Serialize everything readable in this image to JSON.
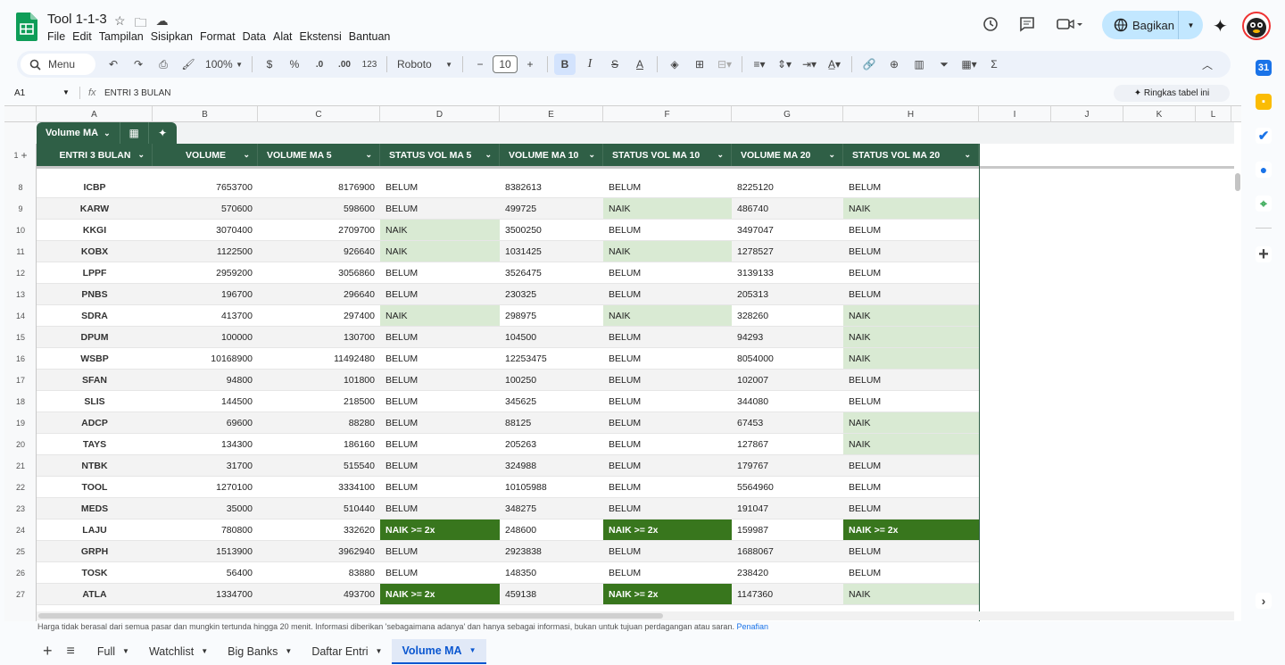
{
  "doc": {
    "title": "Tool 1-1-3"
  },
  "menu": [
    "File",
    "Edit",
    "Tampilan",
    "Sisipkan",
    "Format",
    "Data",
    "Alat",
    "Ekstensi",
    "Bantuan"
  ],
  "share": {
    "label": "Bagikan"
  },
  "toolbar": {
    "search": "Menu",
    "zoom": "100%",
    "currency": "$",
    "percent": "%",
    "dec_less": ".0",
    "dec_more": ".00",
    "num_format": "123",
    "font": "Roboto",
    "font_size": "10",
    "bold": "B",
    "italic": "I",
    "strike": "S",
    "text_color": "A"
  },
  "formula": {
    "cell": "A1",
    "fx": "fx",
    "content": "ENTRI 3 BULAN",
    "summarize": "Ringkas tabel ini"
  },
  "columns": [
    "A",
    "B",
    "C",
    "D",
    "E",
    "F",
    "G",
    "H",
    "I",
    "J",
    "K",
    "L"
  ],
  "table": {
    "name": "Volume MA",
    "headers": [
      "ENTRI 3 BULAN",
      "VOLUME",
      "VOLUME MA 5",
      "STATUS VOL MA 5",
      "VOLUME MA 10",
      "STATUS VOL MA 10",
      "VOLUME MA 20",
      "STATUS VOL MA 20"
    ],
    "rows": [
      {
        "n": "8",
        "t": "ICBP",
        "v": "7653700",
        "m5": "8176900",
        "s5": "BELUM",
        "m10": "8382613",
        "s10": "BELUM",
        "m20": "8225120",
        "s20": "BELUM"
      },
      {
        "n": "9",
        "t": "KARW",
        "v": "570600",
        "m5": "598600",
        "s5": "BELUM",
        "m10": "499725",
        "s10": "NAIK",
        "m20": "486740",
        "s20": "NAIK"
      },
      {
        "n": "10",
        "t": "KKGI",
        "v": "3070400",
        "m5": "2709700",
        "s5": "NAIK",
        "m10": "3500250",
        "s10": "BELUM",
        "m20": "3497047",
        "s20": "BELUM"
      },
      {
        "n": "11",
        "t": "KOBX",
        "v": "1122500",
        "m5": "926640",
        "s5": "NAIK",
        "m10": "1031425",
        "s10": "NAIK",
        "m20": "1278527",
        "s20": "BELUM"
      },
      {
        "n": "12",
        "t": "LPPF",
        "v": "2959200",
        "m5": "3056860",
        "s5": "BELUM",
        "m10": "3526475",
        "s10": "BELUM",
        "m20": "3139133",
        "s20": "BELUM"
      },
      {
        "n": "13",
        "t": "PNBS",
        "v": "196700",
        "m5": "296640",
        "s5": "BELUM",
        "m10": "230325",
        "s10": "BELUM",
        "m20": "205313",
        "s20": "BELUM"
      },
      {
        "n": "14",
        "t": "SDRA",
        "v": "413700",
        "m5": "297400",
        "s5": "NAIK",
        "m10": "298975",
        "s10": "NAIK",
        "m20": "328260",
        "s20": "NAIK"
      },
      {
        "n": "15",
        "t": "DPUM",
        "v": "100000",
        "m5": "130700",
        "s5": "BELUM",
        "m10": "104500",
        "s10": "BELUM",
        "m20": "94293",
        "s20": "NAIK"
      },
      {
        "n": "16",
        "t": "WSBP",
        "v": "10168900",
        "m5": "11492480",
        "s5": "BELUM",
        "m10": "12253475",
        "s10": "BELUM",
        "m20": "8054000",
        "s20": "NAIK"
      },
      {
        "n": "17",
        "t": "SFAN",
        "v": "94800",
        "m5": "101800",
        "s5": "BELUM",
        "m10": "100250",
        "s10": "BELUM",
        "m20": "102007",
        "s20": "BELUM"
      },
      {
        "n": "18",
        "t": "SLIS",
        "v": "144500",
        "m5": "218500",
        "s5": "BELUM",
        "m10": "345625",
        "s10": "BELUM",
        "m20": "344080",
        "s20": "BELUM"
      },
      {
        "n": "19",
        "t": "ADCP",
        "v": "69600",
        "m5": "88280",
        "s5": "BELUM",
        "m10": "88125",
        "s10": "BELUM",
        "m20": "67453",
        "s20": "NAIK"
      },
      {
        "n": "20",
        "t": "TAYS",
        "v": "134300",
        "m5": "186160",
        "s5": "BELUM",
        "m10": "205263",
        "s10": "BELUM",
        "m20": "127867",
        "s20": "NAIK"
      },
      {
        "n": "21",
        "t": "NTBK",
        "v": "31700",
        "m5": "515540",
        "s5": "BELUM",
        "m10": "324988",
        "s10": "BELUM",
        "m20": "179767",
        "s20": "BELUM"
      },
      {
        "n": "22",
        "t": "TOOL",
        "v": "1270100",
        "m5": "3334100",
        "s5": "BELUM",
        "m10": "10105988",
        "s10": "BELUM",
        "m20": "5564960",
        "s20": "BELUM"
      },
      {
        "n": "23",
        "t": "MEDS",
        "v": "35000",
        "m5": "510440",
        "s5": "BELUM",
        "m10": "348275",
        "s10": "BELUM",
        "m20": "191047",
        "s20": "BELUM"
      },
      {
        "n": "24",
        "t": "LAJU",
        "v": "780800",
        "m5": "332620",
        "s5": "NAIK >= 2x",
        "m10": "248600",
        "s10": "NAIK >= 2x",
        "m20": "159987",
        "s20": "NAIK >= 2x"
      },
      {
        "n": "25",
        "t": "GRPH",
        "v": "1513900",
        "m5": "3962940",
        "s5": "BELUM",
        "m10": "2923838",
        "s10": "BELUM",
        "m20": "1688067",
        "s20": "BELUM"
      },
      {
        "n": "26",
        "t": "TOSK",
        "v": "56400",
        "m5": "83880",
        "s5": "BELUM",
        "m10": "148350",
        "s10": "BELUM",
        "m20": "238420",
        "s20": "BELUM"
      },
      {
        "n": "27",
        "t": "ATLA",
        "v": "1334700",
        "m5": "493700",
        "s5": "NAIK >= 2x",
        "m10": "459138",
        "s10": "NAIK >= 2x",
        "m20": "1147360",
        "s20": "NAIK"
      }
    ]
  },
  "disclaimer": {
    "text": "Harga tidak berasal dari semua pasar dan mungkin tertunda hingga 20 menit. Informasi diberikan 'sebagaimana adanya' dan hanya sebagai informasi, bukan untuk tujuan perdagangan atau saran.",
    "link": "Penafian"
  },
  "sheets": [
    {
      "label": "Full",
      "active": false
    },
    {
      "label": "Watchlist",
      "active": false
    },
    {
      "label": "Big Banks",
      "active": false
    },
    {
      "label": "Daftar Entri",
      "active": false
    },
    {
      "label": "Volume MA",
      "active": true
    }
  ],
  "colors": {
    "header_green": "#2f5f46",
    "naik_bg": "#d9ead3",
    "naik2x_bg": "#38761d",
    "share_bg": "#c2e7ff"
  }
}
